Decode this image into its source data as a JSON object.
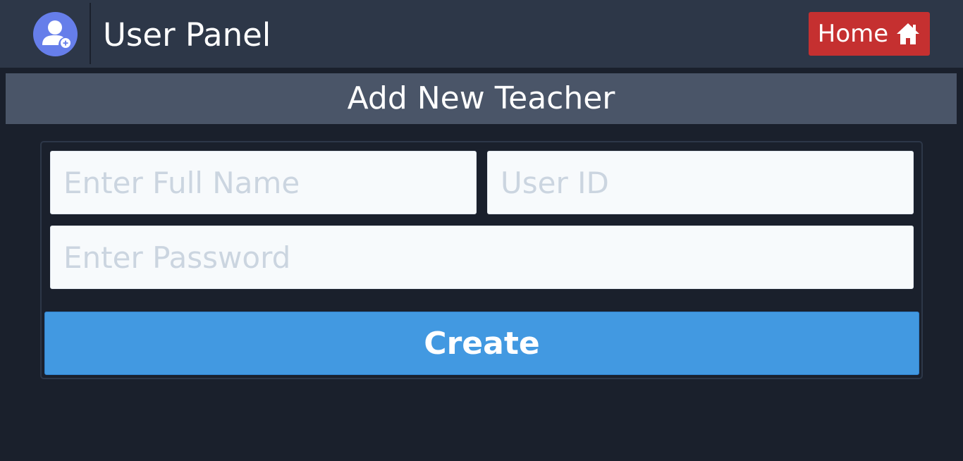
{
  "header": {
    "title": "User Panel",
    "avatar_icon": "user-add-icon",
    "home_button": {
      "label": "Home",
      "icon": "home-icon",
      "color": "#c53030"
    }
  },
  "section": {
    "title": "Add New Teacher"
  },
  "form": {
    "full_name": {
      "placeholder": "Enter Full Name",
      "value": ""
    },
    "user_id": {
      "placeholder": "User ID",
      "value": ""
    },
    "password": {
      "placeholder": "Enter Password",
      "value": ""
    },
    "submit_label": "Create",
    "submit_color": "#4299e1"
  }
}
